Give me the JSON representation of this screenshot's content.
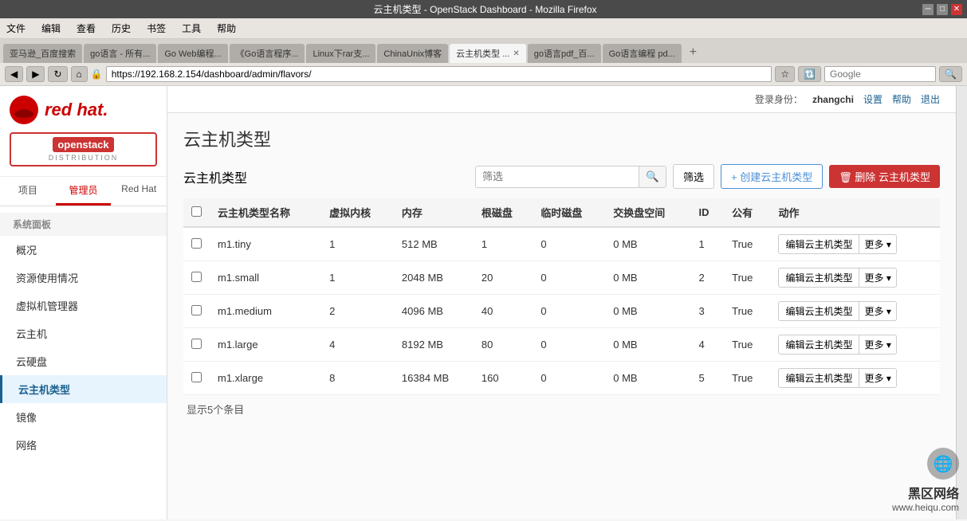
{
  "browser": {
    "title": "云主机类型 - OpenStack Dashboard - Mozilla Firefox",
    "address": "https://192.168.2.154/dashboard/admin/flavors/",
    "search_placeholder": "Google",
    "tabs": [
      {
        "label": "亚马逊_百度搜索",
        "active": false
      },
      {
        "label": "go语言 - 所有...",
        "active": false
      },
      {
        "label": "Go Web编程...",
        "active": false
      },
      {
        "label": "《Go语言程序...",
        "active": false
      },
      {
        "label": "Linux下rar支...",
        "active": false
      },
      {
        "label": "ChinaUnix博客",
        "active": false
      },
      {
        "label": "云主机类型 ...",
        "active": true
      },
      {
        "label": "go语言pdf_百...",
        "active": false
      },
      {
        "label": "Go语言编程 pd...",
        "active": false
      }
    ],
    "menu_items": [
      "文件",
      "编辑",
      "查看",
      "历史",
      "书签",
      "工具",
      "帮助"
    ]
  },
  "sidebar": {
    "tabs": [
      {
        "label": "项目",
        "active": false
      },
      {
        "label": "管理员",
        "active": true
      },
      {
        "label": "Red Hat",
        "active": false
      }
    ],
    "section_title": "系统面板",
    "items": [
      {
        "label": "概况",
        "active": false
      },
      {
        "label": "资源使用情况",
        "active": false
      },
      {
        "label": "虚拟机管理器",
        "active": false
      },
      {
        "label": "云主机",
        "active": false
      },
      {
        "label": "云硬盘",
        "active": false
      },
      {
        "label": "云主机类型",
        "active": true
      },
      {
        "label": "镜像",
        "active": false
      },
      {
        "label": "网络",
        "active": false
      }
    ]
  },
  "topbar": {
    "login_label": "登录身份：",
    "username": "zhangchi",
    "settings": "设置",
    "help": "帮助",
    "logout": "退出"
  },
  "page": {
    "title": "云主机类型",
    "subtitle": "云主机类型",
    "search_placeholder": "筛选",
    "filter_btn": "筛选",
    "create_btn": "+ 创建云主机类型",
    "delete_btn": "删除 云主机类型",
    "table_footer": "显示5个条目"
  },
  "table": {
    "columns": [
      "",
      "云主机类型名称",
      "虚拟内核",
      "内存",
      "根磁盘",
      "临时磁盘",
      "交换盘空间",
      "ID",
      "公有",
      "动作"
    ],
    "rows": [
      {
        "name": "m1.tiny",
        "vcpus": "1",
        "ram": "512 MB",
        "disk": "1",
        "ephemeral": "0",
        "swap": "0 MB",
        "id": "1",
        "public": "True"
      },
      {
        "name": "m1.small",
        "vcpus": "1",
        "ram": "2048 MB",
        "disk": "20",
        "ephemeral": "0",
        "swap": "0 MB",
        "id": "2",
        "public": "True"
      },
      {
        "name": "m1.medium",
        "vcpus": "2",
        "ram": "4096 MB",
        "disk": "40",
        "ephemeral": "0",
        "swap": "0 MB",
        "id": "3",
        "public": "True"
      },
      {
        "name": "m1.large",
        "vcpus": "4",
        "ram": "8192 MB",
        "disk": "80",
        "ephemeral": "0",
        "swap": "0 MB",
        "id": "4",
        "public": "True"
      },
      {
        "name": "m1.xlarge",
        "vcpus": "8",
        "ram": "16384 MB",
        "disk": "160",
        "ephemeral": "0",
        "swap": "0 MB",
        "id": "5",
        "public": "True"
      }
    ],
    "action_edit": "编辑云主机类型",
    "action_more": "更多"
  },
  "watermark": {
    "site": "黑区网络",
    "url": "www.heiqu.com"
  }
}
